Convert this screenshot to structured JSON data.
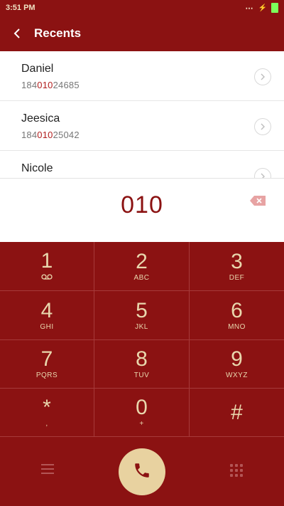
{
  "status": {
    "time": "3:51 PM"
  },
  "header": {
    "title": "Recents"
  },
  "recents": [
    {
      "name": "Daniel",
      "num_prefix": "184",
      "num_match": "010",
      "num_suffix": "24685"
    },
    {
      "name": "Jeesica",
      "num_prefix": "184",
      "num_match": "010",
      "num_suffix": "25042"
    },
    {
      "name": "Nicole",
      "num_prefix": "",
      "num_match": "",
      "num_suffix": ""
    }
  ],
  "display": {
    "digits": "010"
  },
  "keypad": [
    {
      "digit": "1",
      "sub": ""
    },
    {
      "digit": "2",
      "sub": "ABC"
    },
    {
      "digit": "3",
      "sub": "DEF"
    },
    {
      "digit": "4",
      "sub": "GHI"
    },
    {
      "digit": "5",
      "sub": "JKL"
    },
    {
      "digit": "6",
      "sub": "MNO"
    },
    {
      "digit": "7",
      "sub": "PQRS"
    },
    {
      "digit": "8",
      "sub": "TUV"
    },
    {
      "digit": "9",
      "sub": "WXYZ"
    },
    {
      "digit": "*",
      "sub": ","
    },
    {
      "digit": "0",
      "sub": "+"
    },
    {
      "digit": "#",
      "sub": ""
    }
  ],
  "icons": {
    "back": "chevron-left-icon",
    "recent_chevron": "chevron-right-icon",
    "backspace": "backspace-icon",
    "voicemail": "voicemail-icon",
    "menu": "menu-icon",
    "call": "phone-icon",
    "dialpad": "dialpad-icon"
  },
  "colors": {
    "primary": "#8b1212",
    "accent": "#e8d2a0",
    "highlight": "#b21f1f"
  }
}
